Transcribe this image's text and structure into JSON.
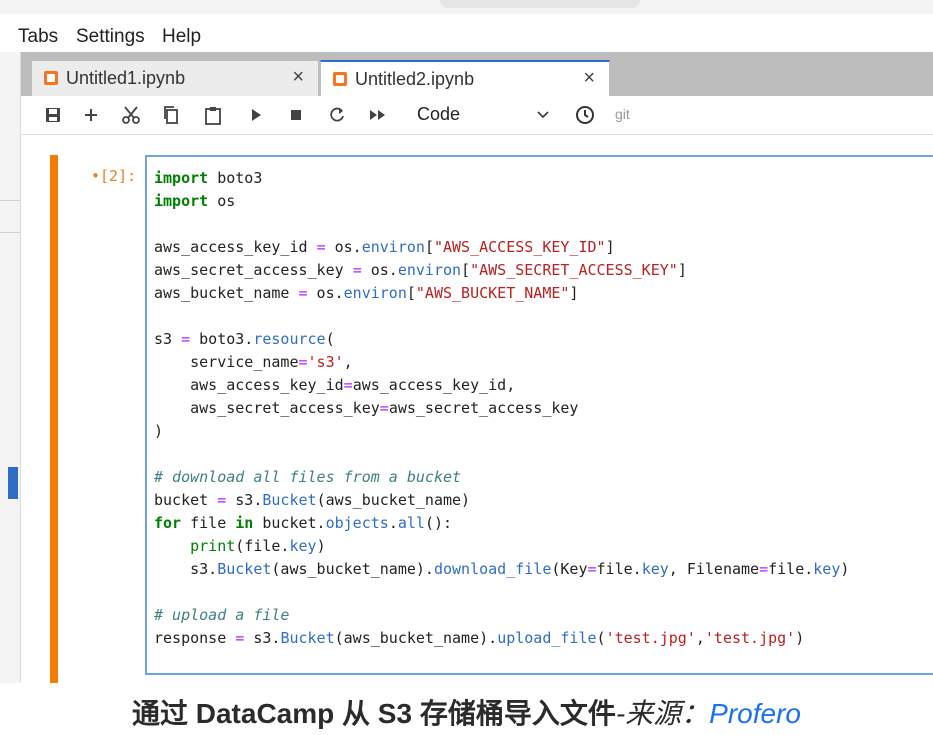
{
  "menubar": {
    "items": [
      "Tabs",
      "Settings",
      "Help"
    ]
  },
  "tabs": [
    {
      "label": "Untitled1.ipynb",
      "active": false,
      "close": "×"
    },
    {
      "label": "Untitled2.ipynb",
      "active": true,
      "close": "×"
    }
  ],
  "toolbar": {
    "icons": [
      "save-icon",
      "add-icon",
      "cut-icon",
      "copy-icon",
      "paste-icon",
      "run-icon",
      "stop-icon",
      "restart-icon",
      "fast-forward-icon",
      "chevron-down-icon",
      "clock-icon"
    ],
    "cell_type": "Code",
    "git_label": "git"
  },
  "cell": {
    "prompt": "•[2]:",
    "code_lines": [
      "import boto3",
      "import os",
      "",
      "aws_access_key_id = os.environ[\"AWS_ACCESS_KEY_ID\"]",
      "aws_secret_access_key = os.environ[\"AWS_SECRET_ACCESS_KEY\"]",
      "aws_bucket_name = os.environ[\"AWS_BUCKET_NAME\"]",
      "",
      "s3 = boto3.resource(",
      "    service_name='s3',",
      "    aws_access_key_id=aws_access_key_id,",
      "    aws_secret_access_key=aws_secret_access_key",
      ")",
      "",
      "# download all files from a bucket",
      "bucket = s3.Bucket(aws_bucket_name)",
      "for file in bucket.objects.all():",
      "    print(file.key)",
      "    s3.Bucket(aws_bucket_name).download_file(Key=file.key, Filename=file.key)",
      "",
      "# upload a file",
      "response = s3.Bucket(aws_bucket_name).upload_file('test.jpg','test.jpg')"
    ]
  },
  "caption": {
    "main": "通过 DataCamp 从 S3 存储桶导入文件",
    "source_prefix": "-来源：",
    "source_name": "Profero"
  },
  "colors": {
    "accent": "#2f6dc4",
    "collapser": "#f57c00",
    "keyword": "#008000",
    "string": "#ba2121",
    "comment": "#408080",
    "link": "#1a73e8"
  }
}
